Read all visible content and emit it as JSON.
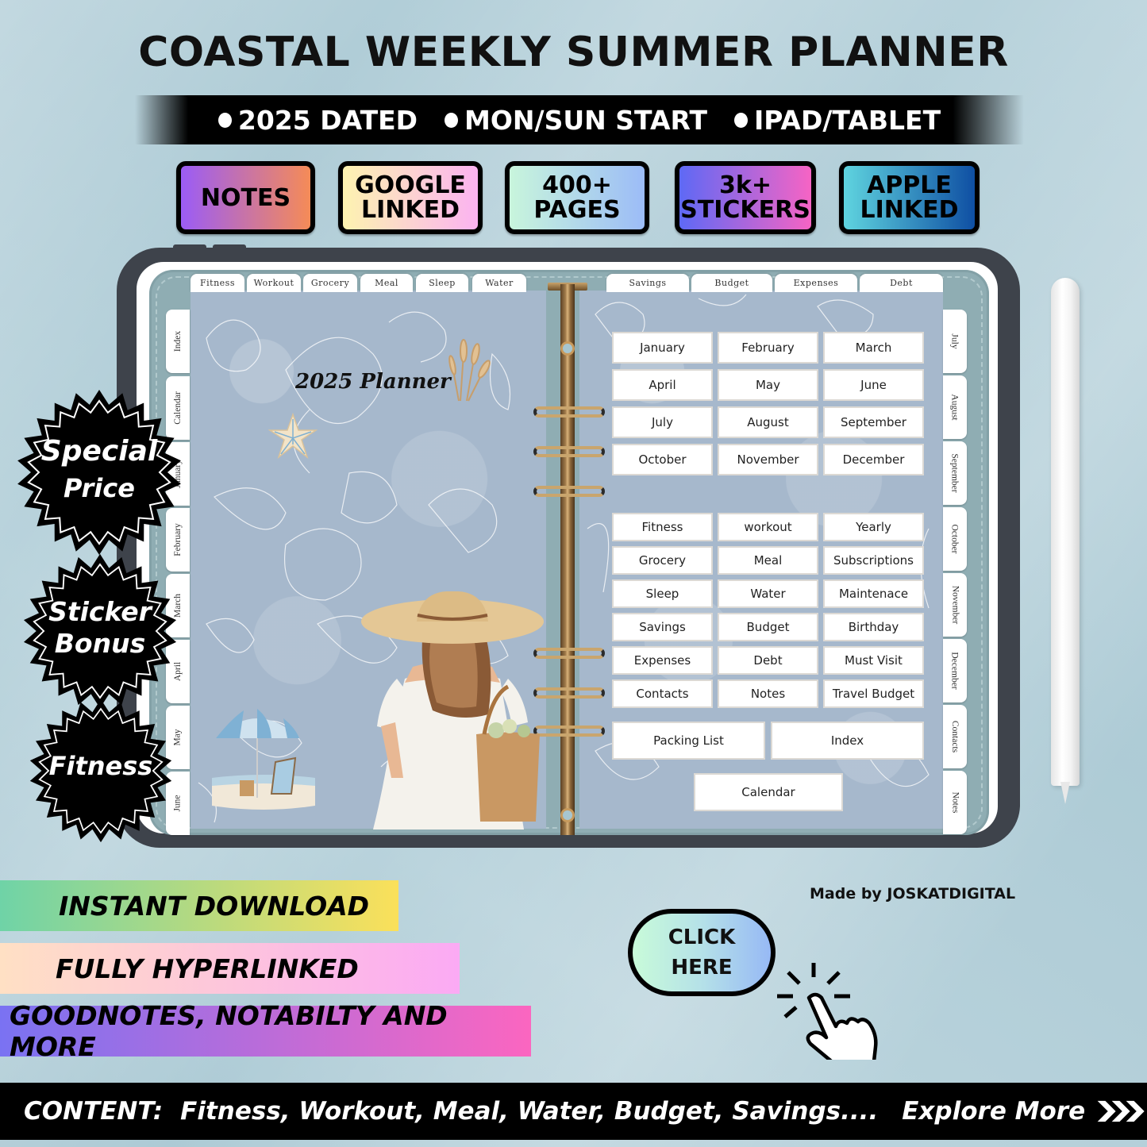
{
  "header": {
    "title": "COASTAL WEEKLY SUMMER PLANNER",
    "features": [
      "2025 DATED",
      "MON/SUN START",
      "IPAD/TABLET"
    ]
  },
  "badges": [
    {
      "line1": "NOTES",
      "line2": "",
      "gradient": [
        "#9b5cf6",
        "#f58b57"
      ]
    },
    {
      "line1": "GOOGLE",
      "line2": "LINKED",
      "gradient": [
        "#fdf3b0",
        "#fbb3f1"
      ]
    },
    {
      "line1": "400+",
      "line2": "PAGES",
      "gradient": [
        "#c8f5dc",
        "#9cbcf7"
      ]
    },
    {
      "line1": "3k+",
      "line2": "STICKERS",
      "gradient": [
        "#5e69f5",
        "#f664c4"
      ]
    },
    {
      "line1": "APPLE",
      "line2": "LINKED",
      "gradient": [
        "#5fd4df",
        "#0f4fa3"
      ]
    }
  ],
  "planner": {
    "cover_title": "2025 Planner",
    "top_tabs_left": [
      "Fitness",
      "Workout",
      "Grocery",
      "Meal",
      "Sleep",
      "Water"
    ],
    "top_tabs_right": [
      "Savings",
      "Budget",
      "Expenses",
      "Debt"
    ],
    "side_tabs_left": [
      "Index",
      "Calendar",
      "January",
      "February",
      "March",
      "April",
      "May",
      "June"
    ],
    "side_tabs_right": [
      "July",
      "August",
      "September",
      "October",
      "November",
      "December",
      "Contacts",
      "Notes"
    ],
    "months": [
      "January",
      "February",
      "March",
      "April",
      "May",
      "June",
      "July",
      "August",
      "September",
      "October",
      "November",
      "December"
    ],
    "sections": [
      "Fitness",
      "workout",
      "Yearly",
      "Grocery",
      "Meal",
      "Subscriptions",
      "Sleep",
      "Water",
      "Maintenace",
      "Savings",
      "Budget",
      "Birthday",
      "Expenses",
      "Debt",
      "Must Visit",
      "Contacts",
      "Notes",
      "Travel Budget"
    ],
    "wide_buttons": [
      "Packing List",
      "Index"
    ],
    "bottom_button": "Calendar"
  },
  "seals": [
    {
      "line1": "Special",
      "line2": "Price"
    },
    {
      "line1": "Sticker",
      "line2": "Bonus"
    },
    {
      "line1": "Fitness",
      "line2": ""
    }
  ],
  "ribbons": [
    {
      "text": "INSTANT DOWNLOAD",
      "gradient": [
        "#6fd3a7",
        "#fbe05a"
      ]
    },
    {
      "text": "FULLY HYPERLINKED",
      "gradient": [
        "#ffe0c4",
        "#fbaaf4"
      ]
    },
    {
      "text": "GOODNOTES, NOTABILTY AND MORE",
      "gradient": [
        "#7a72f2",
        "#fb66c0"
      ]
    }
  ],
  "made_by": "Made by JOSKATDIGITAL",
  "cta": {
    "line1": "CLICK",
    "line2": "HERE"
  },
  "footer": {
    "label": "CONTENT:",
    "items": "Fitness, Workout, Meal, Water, Budget, Savings....",
    "explore": "Explore More"
  },
  "icons": {
    "hand": "pointer-hand-icon",
    "chevrons": "triple-chevron-right-icon"
  }
}
